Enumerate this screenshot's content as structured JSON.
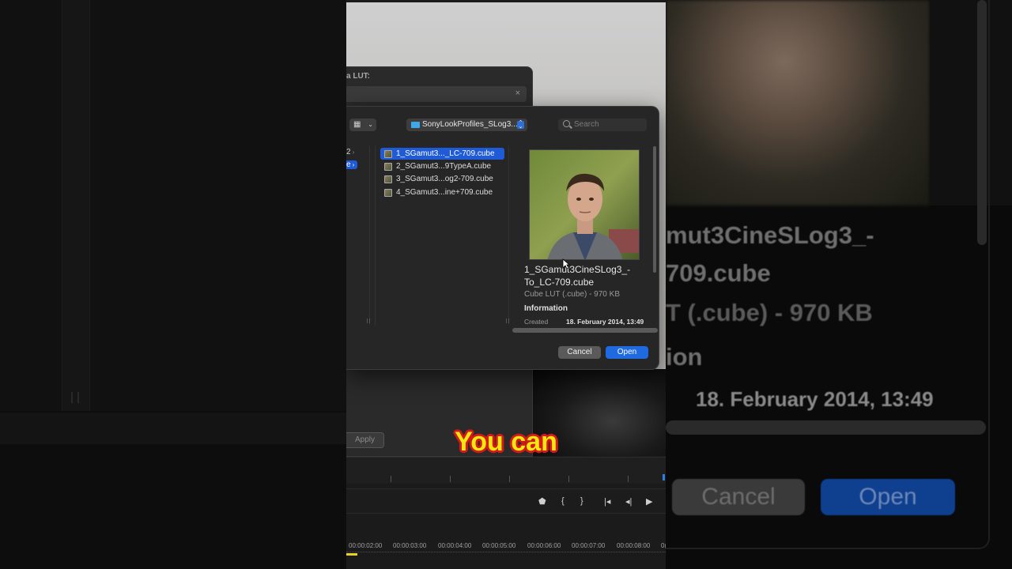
{
  "lut_panel": {
    "title": "a LUT:",
    "clear_icon": "×",
    "apply_label": "Apply"
  },
  "dialog": {
    "view_icon": "grid-icon",
    "folder_name": "SonyLookProfiles_SLog3...",
    "search_placeholder": "Search",
    "sidebar_items": [
      {
        "label": "2",
        "selected": false
      },
      {
        "label": "e",
        "selected": true
      }
    ],
    "files": [
      {
        "name": "1_SGamut3..._LC-709.cube",
        "selected": true
      },
      {
        "name": "2_SGamut3...9TypeA.cube",
        "selected": false
      },
      {
        "name": "3_SGamut3...og2-709.cube",
        "selected": false
      },
      {
        "name": "4_SGamut3...ine+709.cube",
        "selected": false
      }
    ],
    "preview": {
      "name": "1_SGamut3CineSLog3_-To_LC-709.cube",
      "kind": "Cube LUT (.cube) - 970 KB",
      "info_heading": "Information",
      "created_label": "Created",
      "created_value": "18. February 2014, 13:49"
    },
    "cancel_label": "Cancel",
    "open_label": "Open"
  },
  "caption": "You can",
  "timeline": {
    "labels": [
      "00:00:02:00",
      "00:00:03:00",
      "00:00:04:00",
      "00:00:05:00",
      "00:00:06:00",
      "00:00:07:00",
      "00:00:08:00",
      "0("
    ],
    "transport_icons": [
      "marker-icon",
      "in-point-icon",
      "out-point-icon",
      "go-to-start-icon",
      "step-back-icon",
      "play-icon"
    ]
  },
  "background_zoom": {
    "name_line1": "mut3CineSLog3_-",
    "name_line2": "709.cube",
    "kind": "T (.cube) - 970 KB",
    "info": "ion",
    "date": "18. February 2014, 13:49",
    "cancel": "Cancel",
    "open": "Open"
  }
}
